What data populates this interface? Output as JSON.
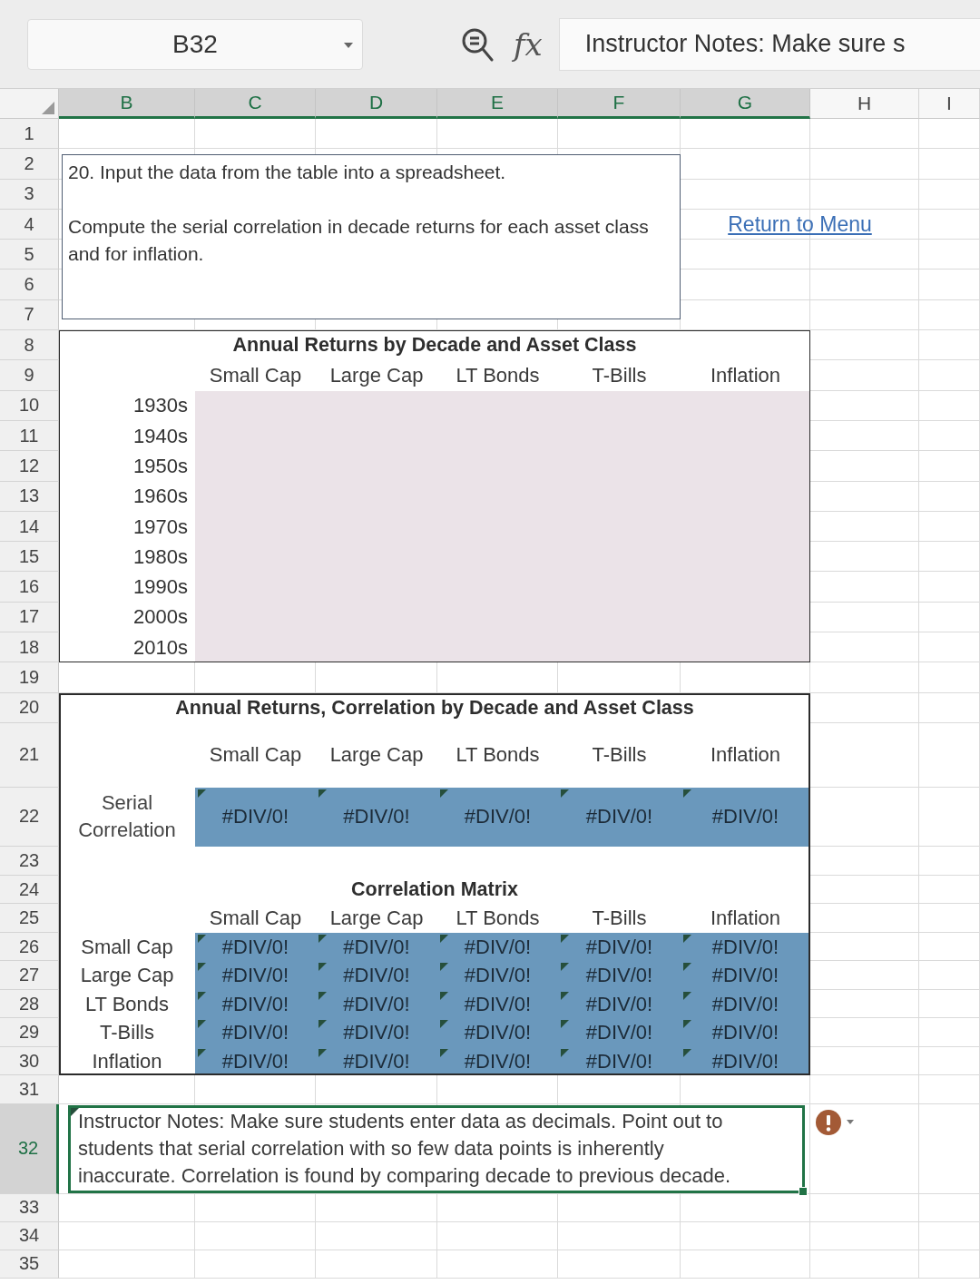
{
  "formula_bar": {
    "name_box": "B32",
    "function_label": "fx",
    "formula": "Instructor Notes: Make sure s"
  },
  "column_headers": [
    {
      "label": "B",
      "selected": true
    },
    {
      "label": "C",
      "selected": true
    },
    {
      "label": "D",
      "selected": true
    },
    {
      "label": "E",
      "selected": true
    },
    {
      "label": "F",
      "selected": true
    },
    {
      "label": "G",
      "selected": true
    },
    {
      "label": "H",
      "selected": false
    },
    {
      "label": "I",
      "selected": false
    }
  ],
  "row_headers": [
    {
      "label": "1",
      "selected": false
    },
    {
      "label": "2",
      "selected": false
    },
    {
      "label": "3",
      "selected": false
    },
    {
      "label": "4",
      "selected": false
    },
    {
      "label": "5",
      "selected": false
    },
    {
      "label": "6",
      "selected": false
    },
    {
      "label": "7",
      "selected": false
    },
    {
      "label": "8",
      "selected": false
    },
    {
      "label": "9",
      "selected": false
    },
    {
      "label": "10",
      "selected": false
    },
    {
      "label": "11",
      "selected": false
    },
    {
      "label": "12",
      "selected": false
    },
    {
      "label": "13",
      "selected": false
    },
    {
      "label": "14",
      "selected": false
    },
    {
      "label": "15",
      "selected": false
    },
    {
      "label": "16",
      "selected": false
    },
    {
      "label": "17",
      "selected": false
    },
    {
      "label": "18",
      "selected": false
    },
    {
      "label": "19",
      "selected": false
    },
    {
      "label": "20",
      "selected": false
    },
    {
      "label": "21",
      "selected": false
    },
    {
      "label": "22",
      "selected": false
    },
    {
      "label": "23",
      "selected": false
    },
    {
      "label": "24",
      "selected": false
    },
    {
      "label": "25",
      "selected": false
    },
    {
      "label": "26",
      "selected": false
    },
    {
      "label": "27",
      "selected": false
    },
    {
      "label": "28",
      "selected": false
    },
    {
      "label": "29",
      "selected": false
    },
    {
      "label": "30",
      "selected": false
    },
    {
      "label": "31",
      "selected": false
    },
    {
      "label": "32",
      "selected": true
    },
    {
      "label": "33",
      "selected": false
    },
    {
      "label": "34",
      "selected": false
    },
    {
      "label": "35",
      "selected": false
    }
  ],
  "instructions": {
    "paragraphs": [
      "20. Input the data from the table into a spreadsheet.",
      "Compute the serial correlation in decade returns for each asset class and for inflation."
    ]
  },
  "menu_link": {
    "label": "Return to Menu"
  },
  "returns_table": {
    "title": "Annual Returns by Decade and Asset Class",
    "columns": [
      "Small Cap",
      "Large Cap",
      "LT Bonds",
      "T-Bills",
      "Inflation"
    ],
    "rows": [
      "1930s",
      "1940s",
      "1950s",
      "1960s",
      "1970s",
      "1980s",
      "1990s",
      "2000s",
      "2010s"
    ]
  },
  "correlation_table": {
    "title": "Annual Returns, Correlation by Decade and Asset Class",
    "columns": [
      "Small Cap",
      "Large Cap",
      "LT Bonds",
      "T-Bills",
      "Inflation"
    ],
    "serial_correlation": {
      "label": "Serial Correlation",
      "cells": [
        {
          "value": "#DIV/0!",
          "flagged": true
        },
        {
          "value": "#DIV/0!",
          "flagged": true
        },
        {
          "value": "#DIV/0!",
          "flagged": true
        },
        {
          "value": "#DIV/0!",
          "flagged": true
        },
        {
          "value": "#DIV/0!",
          "flagged": true
        }
      ]
    },
    "matrix": {
      "title": "Correlation Matrix",
      "columns": [
        "Small Cap",
        "Large Cap",
        "LT Bonds",
        "T-Bills",
        "Inflation"
      ],
      "rows": [
        {
          "label": "Small Cap",
          "cells": [
            {
              "value": "#DIV/0!",
              "flagged": true
            },
            {
              "value": "#DIV/0!",
              "flagged": true
            },
            {
              "value": "#DIV/0!",
              "flagged": true
            },
            {
              "value": "#DIV/0!",
              "flagged": true
            },
            {
              "value": "#DIV/0!",
              "flagged": true
            }
          ]
        },
        {
          "label": "Large Cap",
          "cells": [
            {
              "value": "#DIV/0!",
              "flagged": true
            },
            {
              "value": "#DIV/0!",
              "flagged": true
            },
            {
              "value": "#DIV/0!",
              "flagged": true
            },
            {
              "value": "#DIV/0!",
              "flagged": true
            },
            {
              "value": "#DIV/0!",
              "flagged": true
            }
          ]
        },
        {
          "label": "LT Bonds",
          "cells": [
            {
              "value": "#DIV/0!",
              "flagged": true
            },
            {
              "value": "#DIV/0!",
              "flagged": true
            },
            {
              "value": "#DIV/0!",
              "flagged": true
            },
            {
              "value": "#DIV/0!",
              "flagged": true
            },
            {
              "value": "#DIV/0!",
              "flagged": true
            }
          ]
        },
        {
          "label": "T-Bills",
          "cells": [
            {
              "value": "#DIV/0!",
              "flagged": true
            },
            {
              "value": "#DIV/0!",
              "flagged": true
            },
            {
              "value": "#DIV/0!",
              "flagged": true
            },
            {
              "value": "#DIV/0!",
              "flagged": true
            },
            {
              "value": "#DIV/0!",
              "flagged": true
            }
          ]
        },
        {
          "label": "Inflation",
          "cells": [
            {
              "value": "#DIV/0!",
              "flagged": true
            },
            {
              "value": "#DIV/0!",
              "flagged": true
            },
            {
              "value": "#DIV/0!",
              "flagged": true
            },
            {
              "value": "#DIV/0!",
              "flagged": true
            },
            {
              "value": "#DIV/0!",
              "flagged": true
            }
          ]
        }
      ]
    }
  },
  "note_cell": {
    "text": "Instructor Notes: Make sure students enter data as decimals. Point out to students that serial correlation with so few data points is inherently inaccurate. Correlation is found by comparing decade to previous decade.",
    "selected": true,
    "flagged": true,
    "error_button": true
  }
}
